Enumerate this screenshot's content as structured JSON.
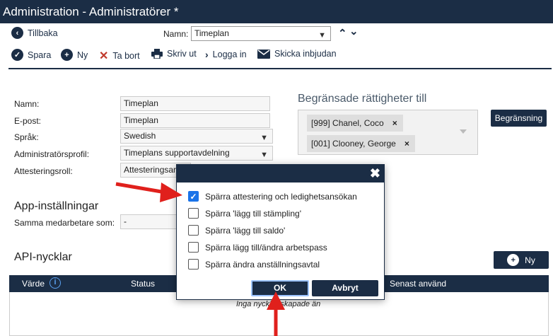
{
  "window": {
    "title": "Administration - Administratörer *"
  },
  "nav": {
    "back_label": "Tillbaka",
    "name_label": "Namn:",
    "name_value": "Timeplan"
  },
  "toolbar": {
    "save": "Spara",
    "new": "Ny",
    "delete": "Ta bort",
    "print": "Skriv ut",
    "login": "Logga in",
    "invite": "Skicka inbjudan"
  },
  "form": {
    "name_label": "Namn:",
    "name_value": "Timeplan",
    "email_label": "E-post:",
    "email_value": "Timeplan",
    "language_label": "Språk:",
    "language_value": "Swedish",
    "profile_label": "Administratörsprofil:",
    "profile_value": "Timeplans supportavdelning",
    "attest_label": "Attesteringsroll:",
    "attest_value": "Attesteringsar"
  },
  "restricted": {
    "heading": "Begränsade rättigheter till",
    "tags": [
      "[999] Chanel, Coco",
      "[001] Clooney, George"
    ],
    "button": "Begränsning"
  },
  "app_settings": {
    "heading": "App-inställningar",
    "same_label": "Samma medarbetare som:",
    "same_value": "-"
  },
  "api": {
    "heading": "API-nycklar",
    "new_button": "Ny",
    "columns": {
      "value": "Värde",
      "status": "Status",
      "last_used": "Senast använd"
    },
    "empty_text": "Inga nycklar skapade än"
  },
  "modal": {
    "options": [
      {
        "label": "Spärra attestering och ledighetsansökan",
        "checked": true
      },
      {
        "label": "Spärra 'lägg till stämpling'",
        "checked": false
      },
      {
        "label": "Spärra 'lägg till saldo'",
        "checked": false
      },
      {
        "label": "Spärra lägg till/ändra arbetspass",
        "checked": false
      },
      {
        "label": "Spärra ändra anställningsavtal",
        "checked": false
      }
    ],
    "ok": "OK",
    "cancel": "Avbryt"
  },
  "colors": {
    "brand": "#1b2d45",
    "annotation_arrow": "#e0201c",
    "checkbox_on": "#1a73e8"
  }
}
